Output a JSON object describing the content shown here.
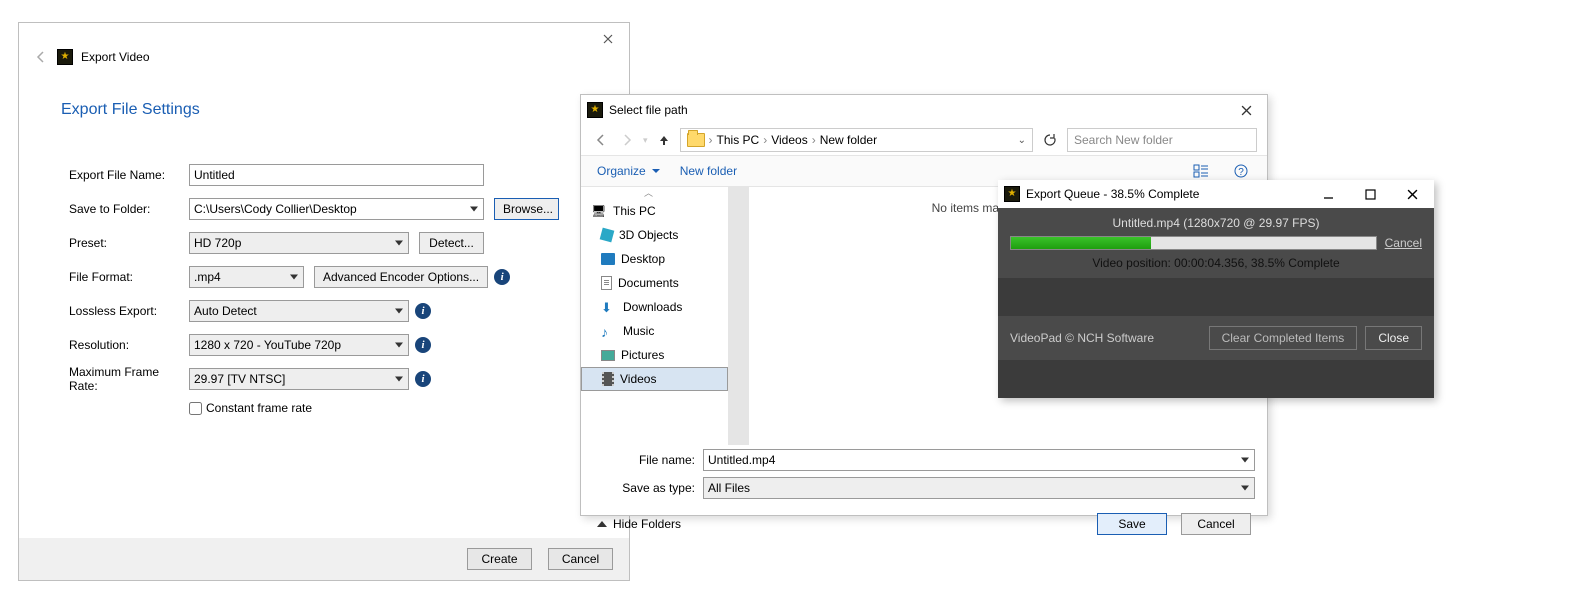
{
  "export_video": {
    "window_title": "Export Video",
    "heading": "Export File Settings",
    "labels": {
      "file_name": "Export File Name:",
      "save_folder": "Save to Folder:",
      "preset": "Preset:",
      "file_format": "File Format:",
      "lossless": "Lossless Export:",
      "resolution": "Resolution:",
      "max_fps": "Maximum Frame Rate:"
    },
    "values": {
      "file_name": "Untitled",
      "save_folder": "C:\\Users\\Cody Collier\\Desktop",
      "preset": "HD 720p",
      "file_format": ".mp4",
      "lossless": "Auto Detect",
      "resolution": "1280 x 720 - YouTube 720p",
      "max_fps": "29.97 [TV NTSC]"
    },
    "buttons": {
      "browse": "Browse...",
      "detect": "Detect...",
      "adv_enc": "Advanced Encoder Options...",
      "create": "Create",
      "cancel": "Cancel"
    },
    "checkbox": {
      "constant_fr": "Constant frame rate",
      "checked": false
    }
  },
  "file_dialog": {
    "title": "Select file path",
    "breadcrumb": [
      "This PC",
      "Videos",
      "New folder"
    ],
    "search_placeholder": "Search New folder",
    "toolbar": {
      "organize": "Organize",
      "new_folder": "New folder"
    },
    "tree": [
      {
        "label": "This PC",
        "icon": "pc",
        "root": true
      },
      {
        "label": "3D Objects",
        "icon": "3d"
      },
      {
        "label": "Desktop",
        "icon": "desktop"
      },
      {
        "label": "Documents",
        "icon": "doc"
      },
      {
        "label": "Downloads",
        "icon": "dl"
      },
      {
        "label": "Music",
        "icon": "music"
      },
      {
        "label": "Pictures",
        "icon": "pic"
      },
      {
        "label": "Videos",
        "icon": "vid",
        "selected": true
      }
    ],
    "empty_message": "No items match your search.",
    "file_name_label": "File name:",
    "file_name_value": "Untitled.mp4",
    "save_type_label": "Save as type:",
    "save_type_value": "All Files",
    "hide_folders": "Hide Folders",
    "save": "Save",
    "cancel": "Cancel"
  },
  "export_queue": {
    "title": "Export Queue - 38.5% Complete",
    "file_info": "Untitled.mp4 (1280x720 @ 29.97 FPS)",
    "progress_percent": 38.5,
    "cancel": "Cancel",
    "position_line": "Video position:  00:00:04.356, 38.5% Complete",
    "footer_label": "VideoPad © NCH Software",
    "clear": "Clear Completed Items",
    "close": "Close"
  }
}
